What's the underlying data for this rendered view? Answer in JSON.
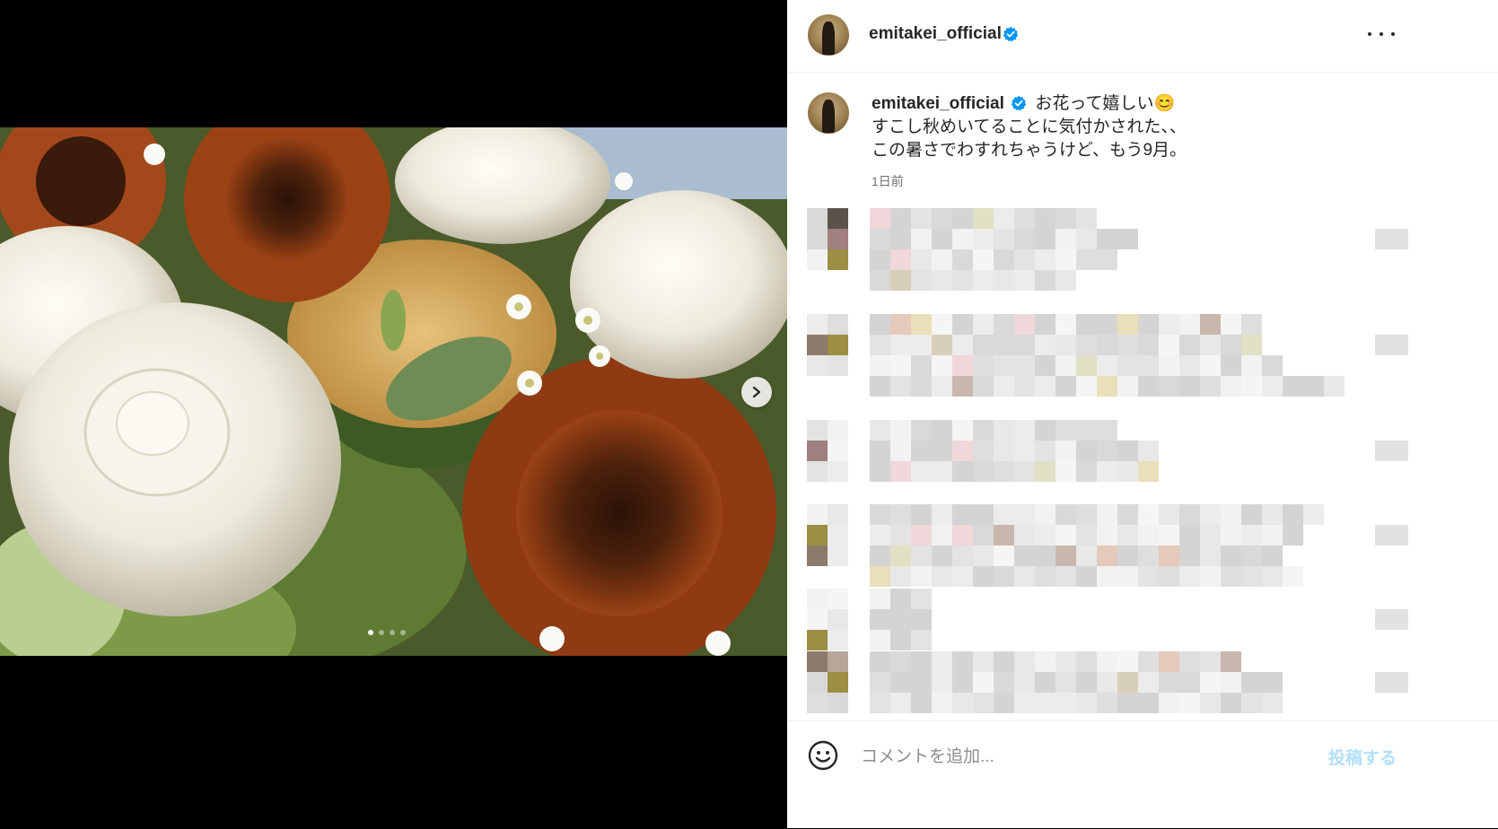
{
  "post": {
    "username": "emitakei_official",
    "caption_lines": [
      "お花って嬉しい😊",
      "すこし秋めいてることに気付かされた、、",
      "この暑さでわすれちゃうけど、もう9月。"
    ],
    "time_ago": "1日前",
    "carousel": {
      "total": 4,
      "current": 1
    }
  },
  "icons": {
    "verified": "verified-badge-icon",
    "more": "more-options-icon",
    "next": "chevron-right-icon",
    "emoji": "emoji-smile-icon"
  },
  "footer": {
    "placeholder": "コメントを追加...",
    "post_label": "投稿する"
  },
  "colors": {
    "verified_blue": "#0095f6",
    "post_disabled": "#b2dffc",
    "text": "#262626",
    "muted": "#737373"
  }
}
